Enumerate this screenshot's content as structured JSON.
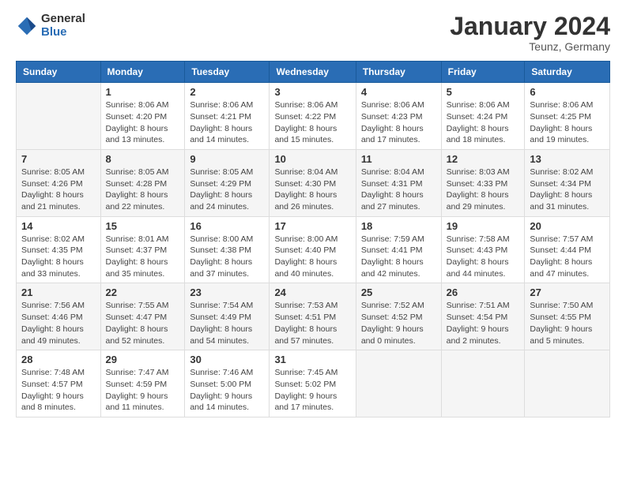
{
  "logo": {
    "general": "General",
    "blue": "Blue"
  },
  "title": "January 2024",
  "location": "Teunz, Germany",
  "weekdays": [
    "Sunday",
    "Monday",
    "Tuesday",
    "Wednesday",
    "Thursday",
    "Friday",
    "Saturday"
  ],
  "weeks": [
    [
      {
        "day": "",
        "sunrise": "",
        "sunset": "",
        "daylight": ""
      },
      {
        "day": "1",
        "sunrise": "Sunrise: 8:06 AM",
        "sunset": "Sunset: 4:20 PM",
        "daylight": "Daylight: 8 hours and 13 minutes."
      },
      {
        "day": "2",
        "sunrise": "Sunrise: 8:06 AM",
        "sunset": "Sunset: 4:21 PM",
        "daylight": "Daylight: 8 hours and 14 minutes."
      },
      {
        "day": "3",
        "sunrise": "Sunrise: 8:06 AM",
        "sunset": "Sunset: 4:22 PM",
        "daylight": "Daylight: 8 hours and 15 minutes."
      },
      {
        "day": "4",
        "sunrise": "Sunrise: 8:06 AM",
        "sunset": "Sunset: 4:23 PM",
        "daylight": "Daylight: 8 hours and 17 minutes."
      },
      {
        "day": "5",
        "sunrise": "Sunrise: 8:06 AM",
        "sunset": "Sunset: 4:24 PM",
        "daylight": "Daylight: 8 hours and 18 minutes."
      },
      {
        "day": "6",
        "sunrise": "Sunrise: 8:06 AM",
        "sunset": "Sunset: 4:25 PM",
        "daylight": "Daylight: 8 hours and 19 minutes."
      }
    ],
    [
      {
        "day": "7",
        "sunrise": "Sunrise: 8:05 AM",
        "sunset": "Sunset: 4:26 PM",
        "daylight": "Daylight: 8 hours and 21 minutes."
      },
      {
        "day": "8",
        "sunrise": "Sunrise: 8:05 AM",
        "sunset": "Sunset: 4:28 PM",
        "daylight": "Daylight: 8 hours and 22 minutes."
      },
      {
        "day": "9",
        "sunrise": "Sunrise: 8:05 AM",
        "sunset": "Sunset: 4:29 PM",
        "daylight": "Daylight: 8 hours and 24 minutes."
      },
      {
        "day": "10",
        "sunrise": "Sunrise: 8:04 AM",
        "sunset": "Sunset: 4:30 PM",
        "daylight": "Daylight: 8 hours and 26 minutes."
      },
      {
        "day": "11",
        "sunrise": "Sunrise: 8:04 AM",
        "sunset": "Sunset: 4:31 PM",
        "daylight": "Daylight: 8 hours and 27 minutes."
      },
      {
        "day": "12",
        "sunrise": "Sunrise: 8:03 AM",
        "sunset": "Sunset: 4:33 PM",
        "daylight": "Daylight: 8 hours and 29 minutes."
      },
      {
        "day": "13",
        "sunrise": "Sunrise: 8:02 AM",
        "sunset": "Sunset: 4:34 PM",
        "daylight": "Daylight: 8 hours and 31 minutes."
      }
    ],
    [
      {
        "day": "14",
        "sunrise": "Sunrise: 8:02 AM",
        "sunset": "Sunset: 4:35 PM",
        "daylight": "Daylight: 8 hours and 33 minutes."
      },
      {
        "day": "15",
        "sunrise": "Sunrise: 8:01 AM",
        "sunset": "Sunset: 4:37 PM",
        "daylight": "Daylight: 8 hours and 35 minutes."
      },
      {
        "day": "16",
        "sunrise": "Sunrise: 8:00 AM",
        "sunset": "Sunset: 4:38 PM",
        "daylight": "Daylight: 8 hours and 37 minutes."
      },
      {
        "day": "17",
        "sunrise": "Sunrise: 8:00 AM",
        "sunset": "Sunset: 4:40 PM",
        "daylight": "Daylight: 8 hours and 40 minutes."
      },
      {
        "day": "18",
        "sunrise": "Sunrise: 7:59 AM",
        "sunset": "Sunset: 4:41 PM",
        "daylight": "Daylight: 8 hours and 42 minutes."
      },
      {
        "day": "19",
        "sunrise": "Sunrise: 7:58 AM",
        "sunset": "Sunset: 4:43 PM",
        "daylight": "Daylight: 8 hours and 44 minutes."
      },
      {
        "day": "20",
        "sunrise": "Sunrise: 7:57 AM",
        "sunset": "Sunset: 4:44 PM",
        "daylight": "Daylight: 8 hours and 47 minutes."
      }
    ],
    [
      {
        "day": "21",
        "sunrise": "Sunrise: 7:56 AM",
        "sunset": "Sunset: 4:46 PM",
        "daylight": "Daylight: 8 hours and 49 minutes."
      },
      {
        "day": "22",
        "sunrise": "Sunrise: 7:55 AM",
        "sunset": "Sunset: 4:47 PM",
        "daylight": "Daylight: 8 hours and 52 minutes."
      },
      {
        "day": "23",
        "sunrise": "Sunrise: 7:54 AM",
        "sunset": "Sunset: 4:49 PM",
        "daylight": "Daylight: 8 hours and 54 minutes."
      },
      {
        "day": "24",
        "sunrise": "Sunrise: 7:53 AM",
        "sunset": "Sunset: 4:51 PM",
        "daylight": "Daylight: 8 hours and 57 minutes."
      },
      {
        "day": "25",
        "sunrise": "Sunrise: 7:52 AM",
        "sunset": "Sunset: 4:52 PM",
        "daylight": "Daylight: 9 hours and 0 minutes."
      },
      {
        "day": "26",
        "sunrise": "Sunrise: 7:51 AM",
        "sunset": "Sunset: 4:54 PM",
        "daylight": "Daylight: 9 hours and 2 minutes."
      },
      {
        "day": "27",
        "sunrise": "Sunrise: 7:50 AM",
        "sunset": "Sunset: 4:55 PM",
        "daylight": "Daylight: 9 hours and 5 minutes."
      }
    ],
    [
      {
        "day": "28",
        "sunrise": "Sunrise: 7:48 AM",
        "sunset": "Sunset: 4:57 PM",
        "daylight": "Daylight: 9 hours and 8 minutes."
      },
      {
        "day": "29",
        "sunrise": "Sunrise: 7:47 AM",
        "sunset": "Sunset: 4:59 PM",
        "daylight": "Daylight: 9 hours and 11 minutes."
      },
      {
        "day": "30",
        "sunrise": "Sunrise: 7:46 AM",
        "sunset": "Sunset: 5:00 PM",
        "daylight": "Daylight: 9 hours and 14 minutes."
      },
      {
        "day": "31",
        "sunrise": "Sunrise: 7:45 AM",
        "sunset": "Sunset: 5:02 PM",
        "daylight": "Daylight: 9 hours and 17 minutes."
      },
      {
        "day": "",
        "sunrise": "",
        "sunset": "",
        "daylight": ""
      },
      {
        "day": "",
        "sunrise": "",
        "sunset": "",
        "daylight": ""
      },
      {
        "day": "",
        "sunrise": "",
        "sunset": "",
        "daylight": ""
      }
    ]
  ]
}
